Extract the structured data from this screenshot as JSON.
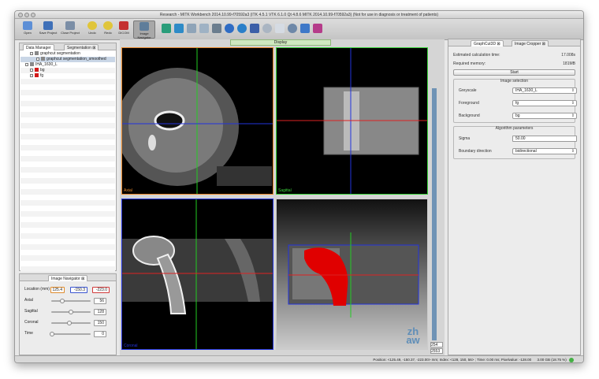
{
  "window": {
    "title": "Research - MITK Workbench 2014.10.99-f70592a3 (ITK 4.5.1  VTK 6.1.0  Qt 4.8.6  MITK 2014.10.99-f70592a3) (Not for use in diagnosis or treatment of patients)"
  },
  "toolbar": {
    "open": "Open",
    "save_project": "Save Project",
    "close_project": "Close Project",
    "undo": "Undo",
    "redo": "Redo",
    "dicom": "DICOM",
    "image_navigator": "Image Navigator"
  },
  "left_panel": {
    "tabs": [
      "Data Manager",
      "Segmentation"
    ],
    "tree": [
      {
        "label": "graphcut segmentation",
        "level": 1
      },
      {
        "label": "graphcut segmentation_smoothed",
        "level": 2,
        "selected": true
      },
      {
        "label": "IHA_1630_L",
        "level": 0
      },
      {
        "label": "bg",
        "level": 1,
        "color": "#d21b1b"
      },
      {
        "label": "fg",
        "level": 1,
        "color": "#d21b1b"
      }
    ]
  },
  "navigator": {
    "title": "Image Navigator",
    "location_label": "Location (mm)",
    "location": [
      "125.4",
      "-150.3",
      "-223.0"
    ],
    "rows": [
      {
        "label": "Axial",
        "value": "56",
        "level": 0.28
      },
      {
        "label": "Sagittal",
        "value": "128",
        "level": 0.5
      },
      {
        "label": "Coronal",
        "value": "150",
        "level": 0.45
      },
      {
        "label": "Time",
        "value": "0",
        "level": 0.0
      }
    ]
  },
  "display": {
    "title": "Display",
    "views": [
      {
        "label": "Axial",
        "color": "#e8882a"
      },
      {
        "label": "Sagittal",
        "color": "#3ad23a"
      },
      {
        "label": "Coronal",
        "color": "#2233dd"
      },
      {
        "label": "3D",
        "color": "#cccccc"
      }
    ],
    "slider_top": "254",
    "slider_bottom": "2553",
    "watermark": "zh aw"
  },
  "right_panel": {
    "tabs": [
      "GraphCut3D",
      "Image Cropper"
    ],
    "estimated_label": "Estimated calculation time:",
    "estimated_value": "17.008s",
    "memory_label": "Required memory:",
    "memory_value": "181MB",
    "start": "Start",
    "image_selection_title": "Image selection",
    "greyscale_label": "Greyscale",
    "greyscale_value": "IHA_1630_L",
    "foreground_label": "Foreground",
    "foreground_value": "fg",
    "background_label": "Background",
    "background_value": "bg",
    "algorithm_title": "Algorithm parameters",
    "sigma_label": "Sigma",
    "sigma_value": "50.00",
    "boundary_label": "Boundary direction",
    "boundary_value": "bidirectional"
  },
  "status": {
    "text": "Position: <125.49, -150.37, -223.00> mm; Index: <128, 150, 56> ; Time: 0.00 ms; Pixelvalue: -128.00",
    "memory": "3.00 GB (18.75 %)"
  }
}
